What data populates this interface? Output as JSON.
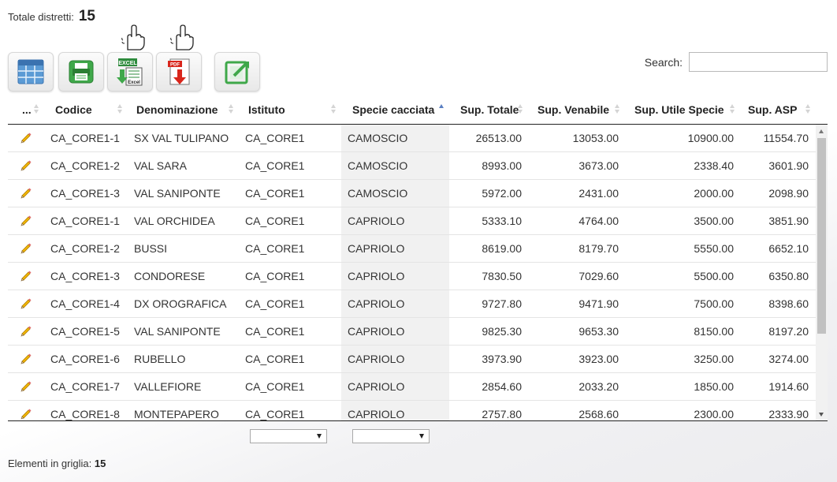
{
  "header": {
    "total_label": "Totale distretti:",
    "total_value": "15"
  },
  "toolbar": {
    "buttons": [
      {
        "name": "grid-view",
        "icon": "grid-icon"
      },
      {
        "name": "print",
        "icon": "print-icon"
      },
      {
        "name": "excel-export",
        "icon": "excel-icon",
        "badge": "EXCEL",
        "sub": "Excel"
      },
      {
        "name": "pdf-export",
        "icon": "pdf-icon",
        "badge": "PDF"
      },
      {
        "name": "edit-export",
        "icon": "export-edit-icon"
      }
    ]
  },
  "search": {
    "label": "Search:",
    "value": "",
    "placeholder": ""
  },
  "table": {
    "columns": [
      "...",
      "Codice",
      "Denominazione",
      "Istituto",
      "Specie cacciata",
      "Sup. Totale",
      "Sup. Venabile",
      "Sup. Utile Specie",
      "Sup. ASP"
    ],
    "sorted_column": "Specie cacciata",
    "sort_direction": "asc",
    "rows": [
      [
        "CA_CORE1-1",
        "SX VAL TULIPANO",
        "CA_CORE1",
        "CAMOSCIO",
        "26513.00",
        "13053.00",
        "10900.00",
        "11554.70"
      ],
      [
        "CA_CORE1-2",
        "VAL SARA",
        "CA_CORE1",
        "CAMOSCIO",
        "8993.00",
        "3673.00",
        "2338.40",
        "3601.90"
      ],
      [
        "CA_CORE1-3",
        "VAL SANIPONTE",
        "CA_CORE1",
        "CAMOSCIO",
        "5972.00",
        "2431.00",
        "2000.00",
        "2098.90"
      ],
      [
        "CA_CORE1-1",
        "VAL ORCHIDEA",
        "CA_CORE1",
        "CAPRIOLO",
        "5333.10",
        "4764.00",
        "3500.00",
        "3851.90"
      ],
      [
        "CA_CORE1-2",
        "BUSSI",
        "CA_CORE1",
        "CAPRIOLO",
        "8619.00",
        "8179.70",
        "5550.00",
        "6652.10"
      ],
      [
        "CA_CORE1-3",
        "CONDORESE",
        "CA_CORE1",
        "CAPRIOLO",
        "7830.50",
        "7029.60",
        "5500.00",
        "6350.80"
      ],
      [
        "CA_CORE1-4",
        "DX OROGRAFICA",
        "CA_CORE1",
        "CAPRIOLO",
        "9727.80",
        "9471.90",
        "7500.00",
        "8398.60"
      ],
      [
        "CA_CORE1-5",
        "VAL SANIPONTE",
        "CA_CORE1",
        "CAPRIOLO",
        "9825.30",
        "9653.30",
        "8150.00",
        "8197.20"
      ],
      [
        "CA_CORE1-6",
        "RUBELLO",
        "CA_CORE1",
        "CAPRIOLO",
        "3973.90",
        "3923.00",
        "3250.00",
        "3274.00"
      ],
      [
        "CA_CORE1-7",
        "VALLEFIORE",
        "CA_CORE1",
        "CAPRIOLO",
        "2854.60",
        "2033.20",
        "1850.00",
        "1914.60"
      ],
      [
        "CA_CORE1-8",
        "MONTEPAPERO",
        "CA_CORE1",
        "CAPRIOLO",
        "2757.80",
        "2568.60",
        "2300.00",
        "2333.90"
      ]
    ]
  },
  "filters": {
    "istituto_value": "",
    "specie_value": ""
  },
  "footer": {
    "label": "Elementi in griglia:",
    "value": "15"
  }
}
